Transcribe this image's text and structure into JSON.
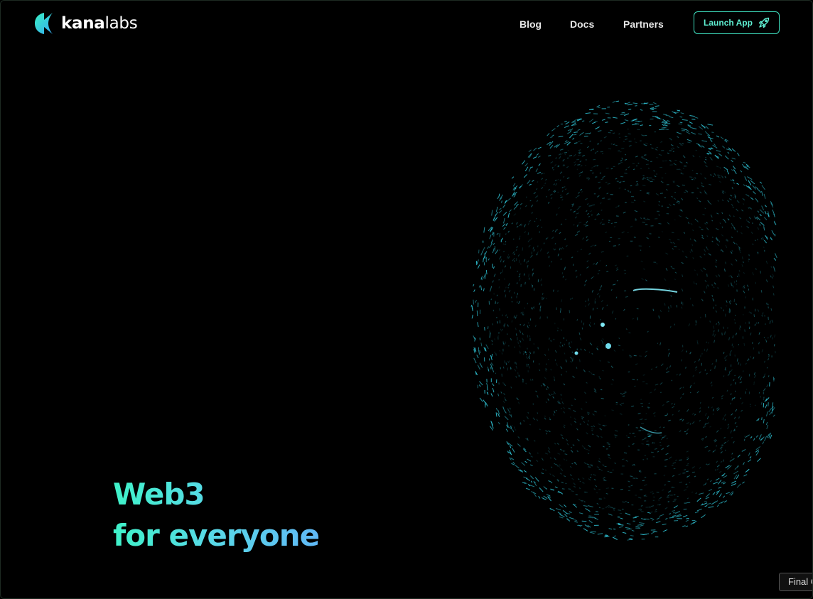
{
  "brand": {
    "name_bold": "kana",
    "name_light": "labs",
    "logo_icon": "kana-logo-icon",
    "accent": "#3fe0c0"
  },
  "nav": {
    "blog": "Blog",
    "docs": "Docs",
    "partners": "Partners"
  },
  "cta": {
    "label": "Launch App",
    "icon": "rocket-icon"
  },
  "hero": {
    "line1": "Web3",
    "line2": "for everyone",
    "gradient": [
      "#3ff2c9",
      "#60b8f6"
    ]
  },
  "visual": {
    "type": "particle-sphere",
    "color": "#2fc4d6"
  },
  "toast": {
    "label": "Final C"
  }
}
